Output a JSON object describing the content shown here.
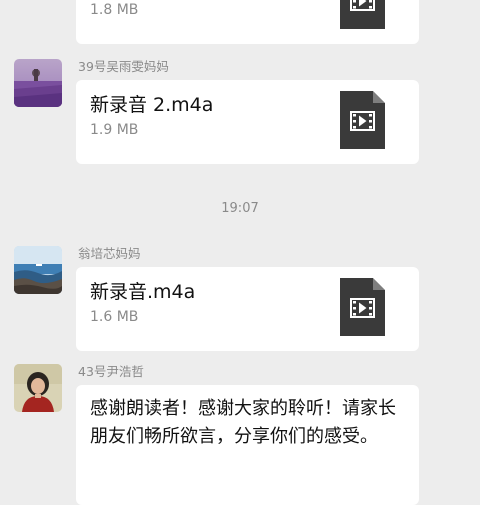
{
  "messages": [
    {
      "sender": "",
      "file_name": "",
      "file_size": "1.8 MB"
    },
    {
      "sender": "39号吴雨雯妈妈",
      "file_name": "新录音 2.m4a",
      "file_size": "1.9 MB"
    },
    {
      "sender": "翁培芯妈妈",
      "file_name": "新录音.m4a",
      "file_size": "1.6 MB"
    },
    {
      "sender": "43号尹浩哲",
      "text": "感谢朗读者！感谢大家的聆听！请家长朋友们畅所欲言，分享你们的感受。"
    }
  ],
  "timestamp": "19:07",
  "icons": {
    "file": "video-file-icon"
  },
  "colors": {
    "background": "#ededed",
    "bubble": "#ffffff",
    "secondary_text": "#8a8a8a",
    "file_icon": "#3a3a3a"
  }
}
